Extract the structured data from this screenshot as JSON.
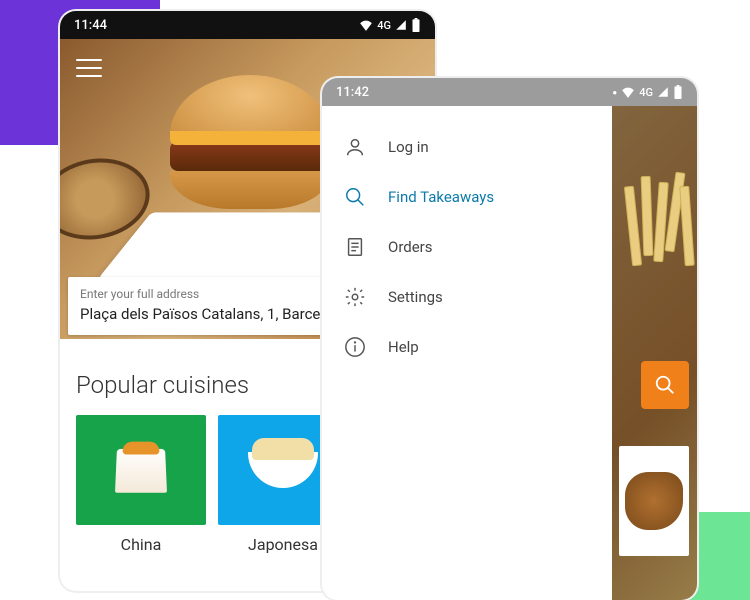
{
  "left": {
    "status_time": "11:44",
    "network": "4G",
    "address_label": "Enter your full address",
    "address_value": "Plaça dels Països Catalans, 1, Barcel",
    "popular_title": "Popular cuisines",
    "cuisines": [
      {
        "label": "China"
      },
      {
        "label": "Japonesa"
      }
    ]
  },
  "right": {
    "status_time": "11:42",
    "network": "4G",
    "menu": [
      {
        "label": "Log in",
        "icon": "person"
      },
      {
        "label": "Find Takeaways",
        "icon": "search",
        "active": true
      },
      {
        "label": "Orders",
        "icon": "receipt"
      },
      {
        "label": "Settings",
        "icon": "gear"
      },
      {
        "label": "Help",
        "icon": "info"
      }
    ]
  }
}
